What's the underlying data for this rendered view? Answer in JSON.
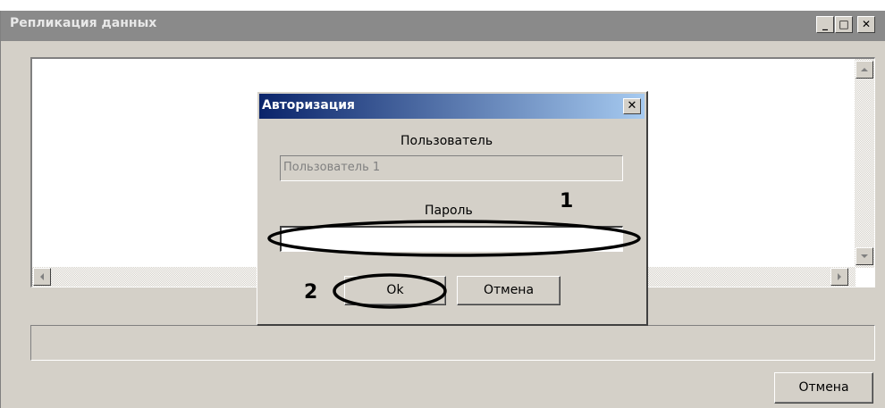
{
  "main_window": {
    "title": "Репликация данных",
    "minimize_glyph": "_",
    "maximize_glyph": "□",
    "close_glyph": "✕",
    "cancel_label": "Отмена"
  },
  "auth_dialog": {
    "title": "Авторизация",
    "close_glyph": "✕",
    "user_label": "Пользователь",
    "user_value": "Пользователь 1",
    "password_label": "Пароль",
    "password_value": "",
    "ok_label": "Ok",
    "cancel_label": "Отмена"
  },
  "annotations": {
    "marker_1": "1",
    "marker_2": "2"
  },
  "icons": {
    "scroll_up": "arrow-up-icon",
    "scroll_down": "arrow-down-icon",
    "scroll_left": "arrow-left-icon",
    "scroll_right": "arrow-right-icon"
  }
}
